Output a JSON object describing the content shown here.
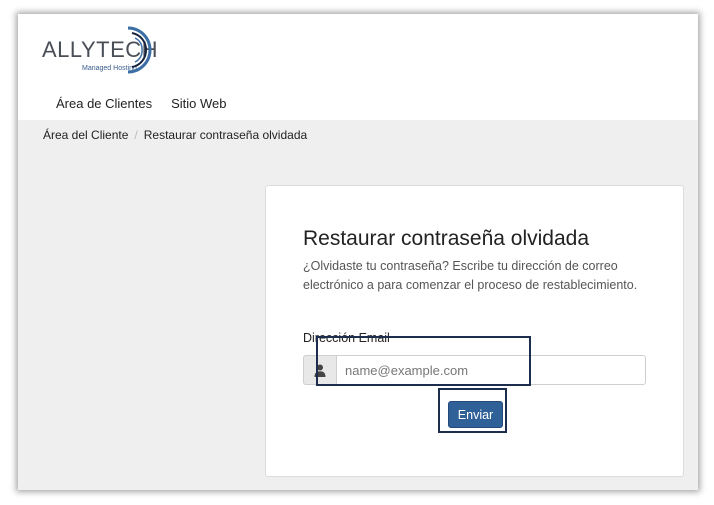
{
  "logo": {
    "name": "ALLYTECH",
    "tagline": "Managed Hosting"
  },
  "nav": {
    "items": [
      {
        "label": "Área de Clientes"
      },
      {
        "label": "Sitio Web"
      }
    ]
  },
  "breadcrumb": {
    "items": [
      {
        "label": "Área del Cliente"
      },
      {
        "label": "Restaurar contraseña olvidada"
      }
    ],
    "separator": "/"
  },
  "card": {
    "title": "Restaurar contraseña olvidada",
    "description": "¿Olvidaste tu contraseña? Escribe tu dirección de correo electrónico a para comenzar el proceso de restablecimiento.",
    "email_label": "Dirección Email",
    "email_placeholder": "name@example.com",
    "email_value": "",
    "submit_label": "Enviar",
    "user_icon": "user-icon"
  },
  "colors": {
    "primary_button": "#2f6098",
    "highlight_border": "#1d2d4d",
    "logo_arc": "#3a6ea5"
  }
}
